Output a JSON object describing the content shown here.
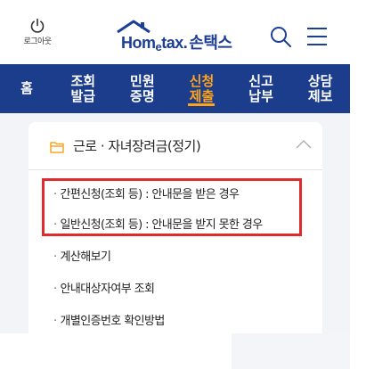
{
  "header": {
    "logout_label": "로그아웃",
    "logo_text_a": "Hom",
    "logo_text_e": "e",
    "logo_text_b": "tax.",
    "logo_text_kr": "손택스"
  },
  "nav": {
    "items": [
      {
        "label": "홈",
        "active": false
      },
      {
        "label": "조회 발급",
        "active": false
      },
      {
        "label": "민원 증명",
        "active": false
      },
      {
        "label": "신청 제출",
        "active": true
      },
      {
        "label": "신고 납부",
        "active": false
      },
      {
        "label": "상담 제보",
        "active": false
      }
    ]
  },
  "section": {
    "title": "근로 · 자녀장려금(정기)",
    "items": [
      "간편신청(조회 등) : 안내문을 받은 경우",
      "일반신청(조회 등) : 안내문을 받지 못한 경우",
      "계산해보기",
      "안내대상자여부 조회",
      "개별인증번호 확인방법"
    ]
  },
  "colors": {
    "brand_blue": "#1b3d8c",
    "nav_active": "#ffa31a",
    "highlight_red": "#e02b2b",
    "folder_orange": "#f5a623"
  }
}
